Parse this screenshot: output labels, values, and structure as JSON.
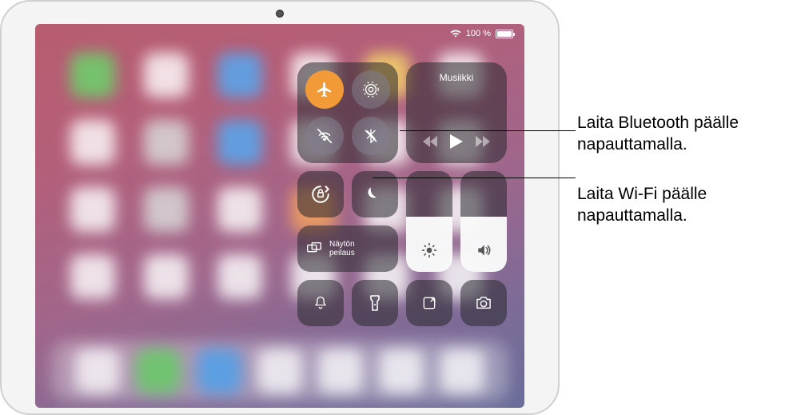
{
  "status": {
    "battery_text": "100 %"
  },
  "control_center": {
    "media_title": "Musiikki",
    "mirror_label": "Näytön\npeilaus",
    "brightness_level": 0.55,
    "volume_level": 0.55
  },
  "callouts": {
    "bluetooth": "Laita Bluetooth päälle napauttamalla.",
    "wifi": "Laita Wi-Fi päälle napauttamalla."
  },
  "icons": {
    "airplane": "airplane-icon",
    "airdrop": "airdrop-icon",
    "wifi": "wifi-icon",
    "bluetooth": "bluetooth-icon",
    "rotation_lock": "rotation-lock-icon",
    "dnd": "do-not-disturb-icon",
    "mirror": "screen-mirror-icon",
    "brightness": "brightness-icon",
    "volume": "volume-icon",
    "mute": "bell-icon",
    "torch": "flashlight-icon",
    "note": "note-icon",
    "camera": "camera-icon",
    "prev": "prev-track-icon",
    "play": "play-icon",
    "next": "next-track-icon"
  }
}
